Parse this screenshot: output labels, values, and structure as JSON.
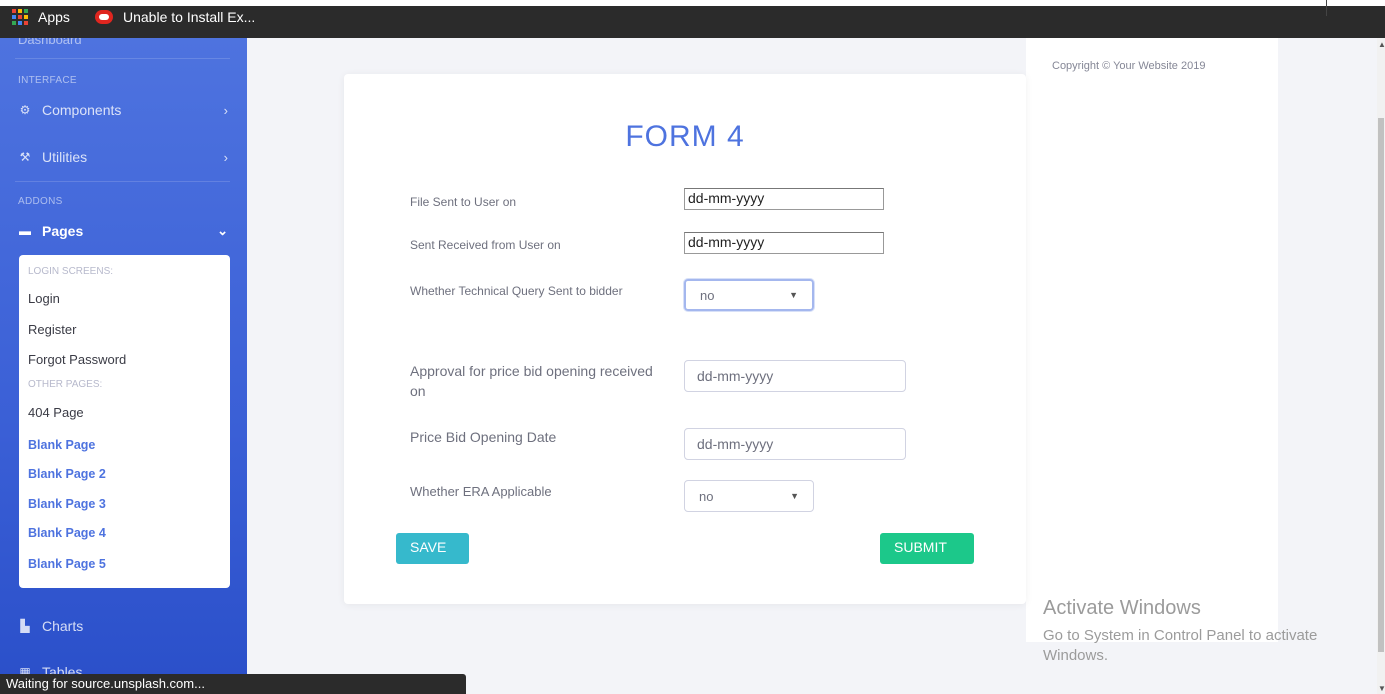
{
  "browser": {
    "bookmarks": [
      {
        "label": "Apps",
        "icon": "apps-grid-icon"
      },
      {
        "label": "Unable to Install Ex...",
        "icon": "extension-error-icon"
      }
    ],
    "status_text": "Waiting for source.unsplash.com..."
  },
  "sidebar": {
    "cut_item": "Dashboard",
    "sections": {
      "interface": "INTERFACE",
      "addons": "ADDONS"
    },
    "items": [
      {
        "label": "Components",
        "icon": "gear-icon"
      },
      {
        "label": "Utilities",
        "icon": "wrench-icon"
      },
      {
        "label": "Pages",
        "icon": "folder-icon"
      },
      {
        "label": "Charts",
        "icon": "chart-icon"
      },
      {
        "label": "Tables",
        "icon": "table-icon"
      }
    ],
    "pages_menu": {
      "login_header": "LOGIN SCREENS:",
      "other_header": "OTHER PAGES:",
      "login_items": [
        "Login",
        "Register",
        "Forgot Password"
      ],
      "other_items": [
        "404 Page",
        "Blank Page",
        "Blank Page 2",
        "Blank Page 3",
        "Blank Page 4",
        "Blank Page 5"
      ]
    }
  },
  "form": {
    "title": "FORM 4",
    "fields": [
      {
        "label": "File Sent to User on",
        "value": "dd-mm-yyyy"
      },
      {
        "label": "Sent Received from User on",
        "value": "dd-mm-yyyy"
      },
      {
        "label": "Whether Technical Query Sent to bidder",
        "value": "no"
      },
      {
        "label": "Approval for price bid opening received on",
        "value": "dd-mm-yyyy"
      },
      {
        "label": "Price Bid Opening Date",
        "value": "dd-mm-yyyy"
      },
      {
        "label": "Whether ERA Applicable",
        "value": "no"
      }
    ],
    "save_label": "SAVE",
    "submit_label": "SUBMIT"
  },
  "footer": {
    "copyright": "Copyright © Your Website 2019"
  },
  "watermark": {
    "title": "Activate Windows",
    "text": "Go to System in Control Panel to activate Windows."
  },
  "colors": {
    "primary": "#4e73df",
    "info": "#36b9cc",
    "success": "#1cc88a"
  }
}
